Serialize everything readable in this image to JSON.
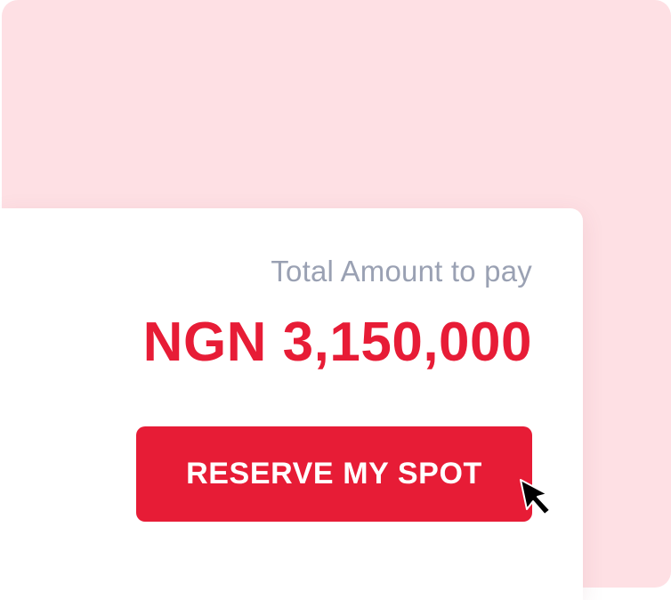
{
  "payment": {
    "label": "Total Amount to pay",
    "amount": "NGN 3,150,000"
  },
  "actions": {
    "reserve_label": "RESERVE MY SPOT"
  },
  "colors": {
    "accent": "#e71c36",
    "background_tint": "#fee0e4",
    "muted_text": "#9aa1b3",
    "card": "#ffffff"
  },
  "icons": {
    "cursor": "pointer-cursor-icon"
  }
}
